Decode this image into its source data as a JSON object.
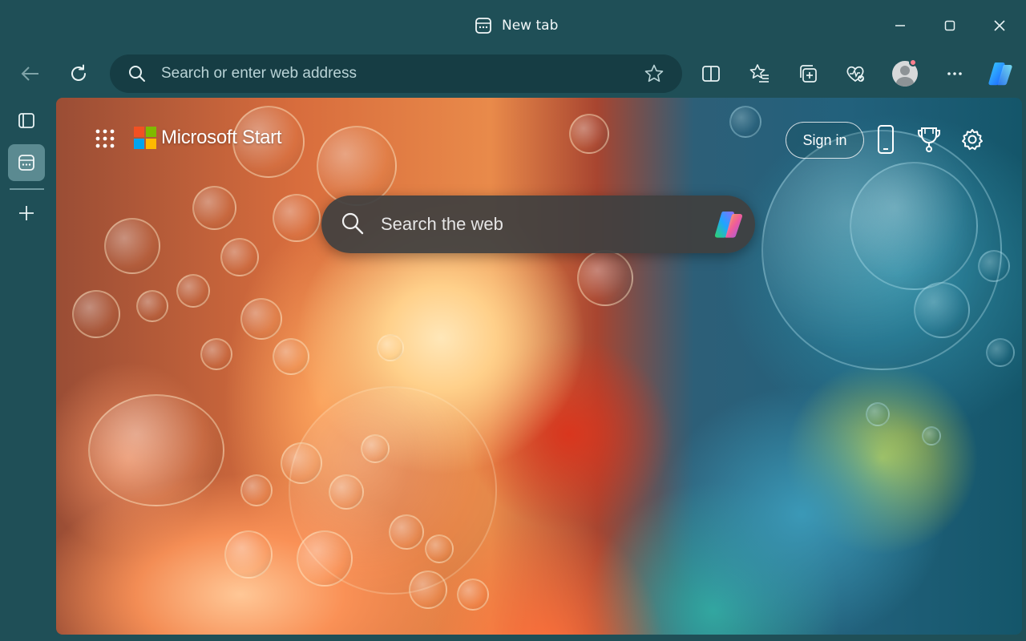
{
  "window": {
    "tab_title": "New tab"
  },
  "toolbar": {
    "address_placeholder": "Search or enter web address"
  },
  "new_tab_page": {
    "brand": "Microsoft Start",
    "sign_in_label": "Sign in",
    "search_placeholder": "Search the web"
  },
  "colors": {
    "chrome_bg": "#1f4f57",
    "address_bar_bg": "#163d44",
    "active_vertical_tab": "#5b8a91",
    "search_box_bg": "#404040",
    "ms_red": "#f25022",
    "ms_green": "#7fba00",
    "ms_blue": "#00a4ef",
    "ms_yellow": "#ffb900"
  },
  "icons": {
    "tab": "new-tab-page-icon",
    "minimize": "minimize-icon",
    "maximize": "maximize-icon",
    "close": "close-icon",
    "back": "back-arrow-icon",
    "refresh": "refresh-icon",
    "search": "search-icon",
    "favorite": "star-icon",
    "split_screen": "split-screen-icon",
    "favorites": "favorites-icon",
    "collections": "collections-icon",
    "browser_essentials": "health-heart-icon",
    "profile": "profile-avatar",
    "more": "more-dots-icon",
    "copilot": "copilot-icon",
    "tab_actions": "tab-actions-icon",
    "add_tab": "plus-icon",
    "apps": "app-launcher-grid-icon",
    "phone": "mobile-phone-icon",
    "rewards": "trophy-icon",
    "settings": "gear-icon"
  }
}
